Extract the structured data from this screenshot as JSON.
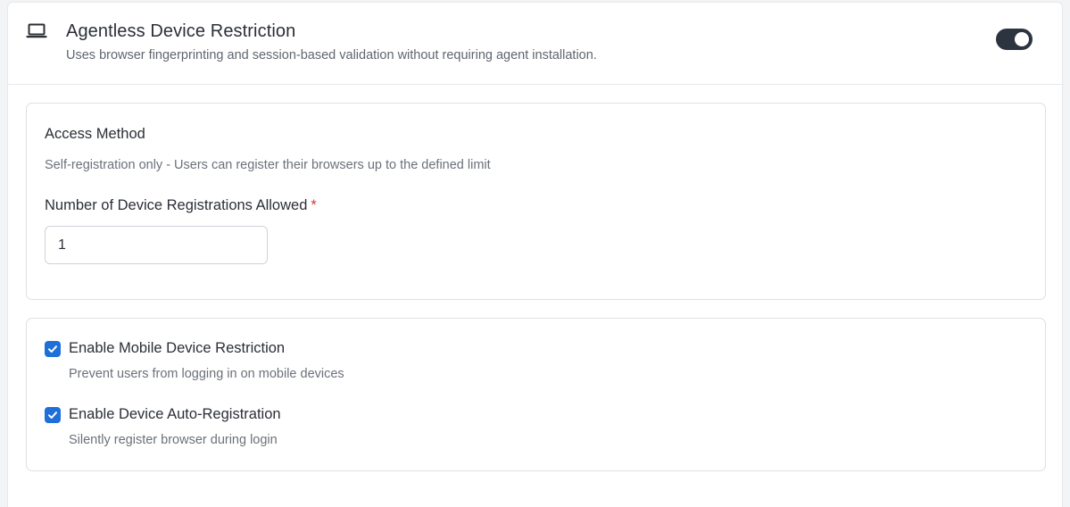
{
  "header": {
    "icon": "laptop-icon",
    "title": "Agentless Device Restriction",
    "description": "Uses browser fingerprinting and session-based validation without requiring agent installation.",
    "toggle_on": true
  },
  "access": {
    "title": "Access Method",
    "description": "Self-registration only - Users can register their browsers up to the defined limit",
    "field_label": "Number of Device Registrations Allowed",
    "required_mark": "*",
    "value": "1"
  },
  "options": [
    {
      "label": "Enable Mobile Device Restriction",
      "description": "Prevent users from logging in on mobile devices",
      "checked": true
    },
    {
      "label": "Enable Device Auto-Registration",
      "description": "Silently register browser during login",
      "checked": true
    }
  ],
  "colors": {
    "accent": "#1f6fd8",
    "toggle": "#2c3440",
    "required": "#d33c3c"
  }
}
